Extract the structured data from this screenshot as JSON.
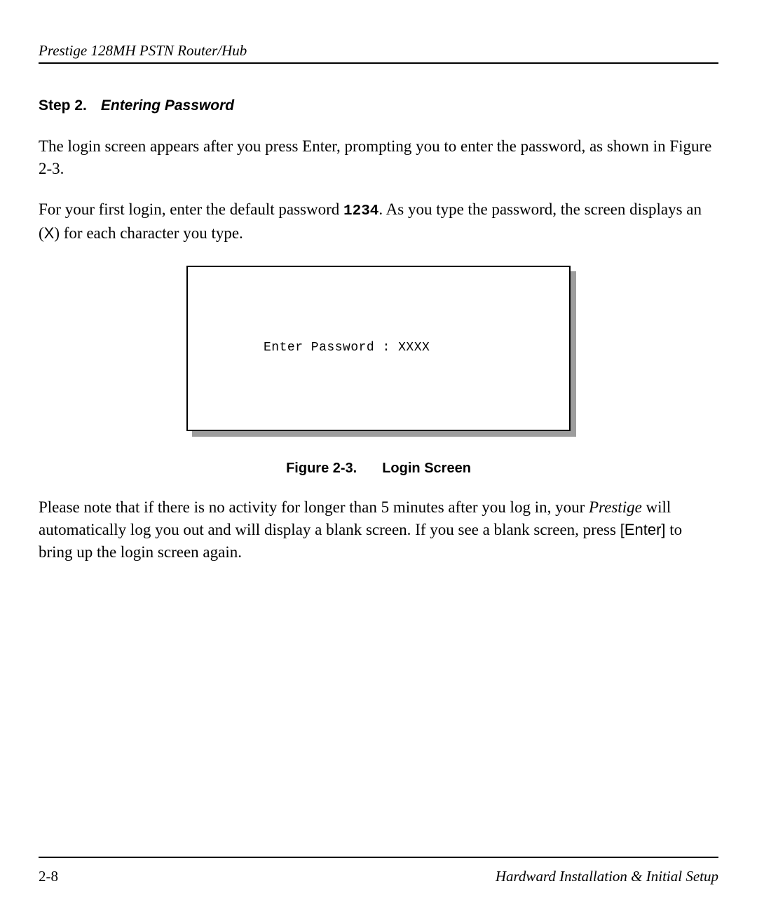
{
  "header": {
    "running_title": "Prestige 128MH  PSTN Router/Hub"
  },
  "step": {
    "label": "Step 2.",
    "title": "Entering Password"
  },
  "paragraphs": {
    "p1": "The login screen appears after you press Enter, prompting you to enter the password, as shown in Figure 2-3.",
    "p2_pre": "For your first login, enter the default password ",
    "p2_pw": "1234",
    "p2_mid": ".   As you type the password, the screen displays an (",
    "p2_x": "X",
    "p2_post": ") for each character you type.",
    "p3_pre": "Please note that if there is no activity for longer than 5 minutes after you log in, your ",
    "p3_prestige": "Prestige",
    "p3_mid": " will automatically log you out and will display a blank screen.  If you see a blank screen, press ",
    "p3_key_open": "[",
    "p3_key": "Enter",
    "p3_key_close": "]",
    "p3_post": " to bring up the login screen again."
  },
  "figure": {
    "terminal_line": "Enter Password : XXXX",
    "caption_label": "Figure 2-3.",
    "caption_title": "Login Screen"
  },
  "footer": {
    "page_number": "2-8",
    "section_title": "Hardward Installation & Initial Setup"
  }
}
